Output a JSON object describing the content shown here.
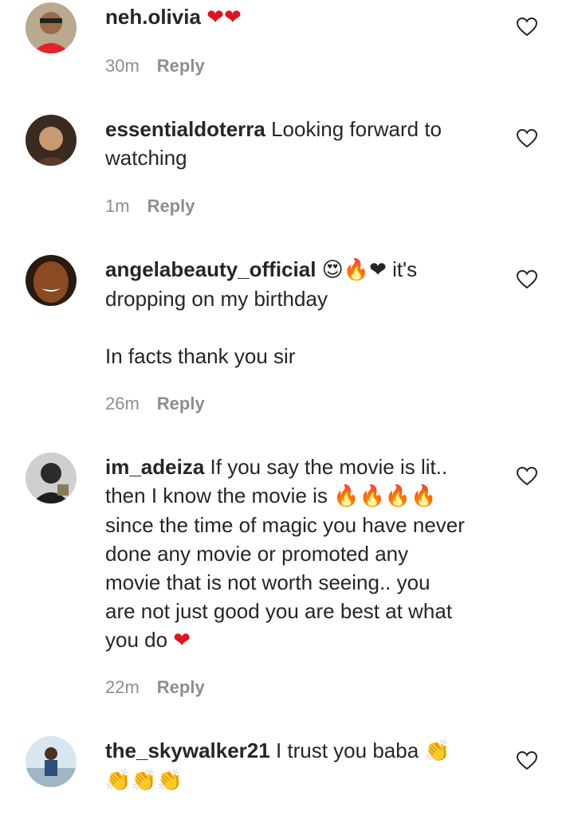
{
  "comments": [
    {
      "username": "neh.olivia",
      "text_before": " ",
      "emojis": "❤❤",
      "text_after": "",
      "time": "30m",
      "reply": "Reply"
    },
    {
      "username": "essentialdoterra",
      "text": " Looking forward to\nwatching",
      "time": "1m",
      "reply": "Reply"
    },
    {
      "username": "angelabeauty_official",
      "emojis": "😍🔥❤",
      "text": " it's\ndropping on my birthday\n\nIn facts thank you sir",
      "time": "26m",
      "reply": "Reply"
    },
    {
      "username": "im_adeiza",
      "text1": " If you say the movie is lit..\nthen I know the movie is ",
      "emojis1": "🔥🔥🔥🔥",
      "text2": "\nsince the time of magic you have never\ndone any movie or promoted any\nmovie that is not worth seeing.. you\nare not just good you are best at what\nyou do ",
      "emojis2": "❤",
      "time": "22m",
      "reply": "Reply"
    },
    {
      "username": "the_skywalker21",
      "text": " I trust you baba ",
      "emojis": "👏\n👏👏👏",
      "time": "",
      "reply": ""
    }
  ],
  "icons": {
    "like": "heart-outline-icon",
    "avatar": "avatar"
  },
  "colors": {
    "text": "#262626",
    "meta": "#8e8e8e",
    "heart": "#e0141e",
    "fire": "#f06a1a"
  }
}
